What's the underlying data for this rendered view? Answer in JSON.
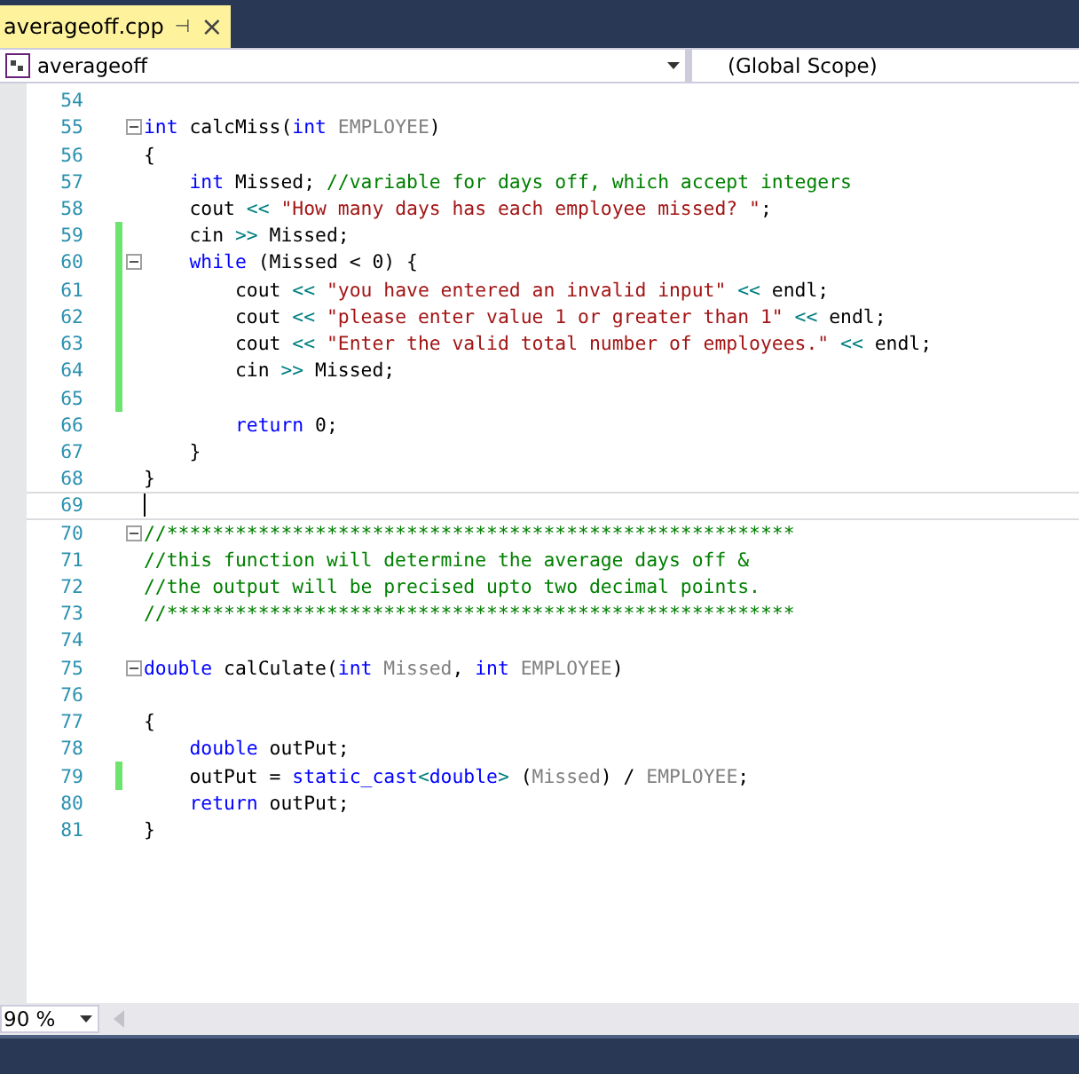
{
  "tab": {
    "title": "averageoff.cpp",
    "pin": "⊣",
    "close": "×",
    "selected": true
  },
  "navigation": {
    "project": "averageoff",
    "scope": "(Global Scope)"
  },
  "lines": [
    {
      "number": "54",
      "changed": false,
      "fold": false,
      "current": false
    },
    {
      "number": "55",
      "changed": false,
      "fold": true,
      "current": false,
      "tokens": [
        {
          "kind": "kw",
          "text": "int"
        },
        {
          "kind": "text",
          "text": " calcMiss("
        },
        {
          "kind": "kw",
          "text": "int"
        },
        {
          "kind": "param",
          "text": " EMPLOYEE"
        },
        {
          "kind": "text",
          "text": ")"
        }
      ]
    },
    {
      "number": "56",
      "changed": false,
      "fold": false,
      "current": false,
      "tokens": [
        {
          "kind": "text",
          "text": "{"
        }
      ]
    },
    {
      "number": "57",
      "changed": false,
      "fold": false,
      "current": false,
      "tokens": [
        {
          "kind": "kw",
          "text": "    int"
        },
        {
          "kind": "text",
          "text": " Missed; "
        },
        {
          "kind": "cmt",
          "text": "//variable for days off, which accept integers"
        }
      ]
    },
    {
      "number": "58",
      "changed": false,
      "fold": false,
      "current": false,
      "tokens": [
        {
          "kind": "text",
          "text": "    cout "
        },
        {
          "kind": "op",
          "text": "<<"
        },
        {
          "kind": "str",
          "text": " \"How many days has each employee missed? \""
        },
        {
          "kind": "text",
          "text": ";"
        }
      ]
    },
    {
      "number": "59",
      "changed": true,
      "fold": false,
      "current": false,
      "tokens": [
        {
          "kind": "text",
          "text": "    cin "
        },
        {
          "kind": "op",
          "text": ">>"
        },
        {
          "kind": "text",
          "text": " Missed;"
        }
      ]
    },
    {
      "number": "60",
      "changed": true,
      "fold": true,
      "current": false,
      "tokens": [
        {
          "kind": "kw",
          "text": "    while"
        },
        {
          "kind": "text",
          "text": " (Missed < 0) {"
        }
      ]
    },
    {
      "number": "61",
      "changed": true,
      "fold": false,
      "current": false,
      "tokens": [
        {
          "kind": "text",
          "text": "        cout "
        },
        {
          "kind": "op",
          "text": "<<"
        },
        {
          "kind": "str",
          "text": " \"you have entered an invalid input\""
        },
        {
          "kind": "op",
          "text": " <<"
        },
        {
          "kind": "text",
          "text": " endl;"
        }
      ]
    },
    {
      "number": "62",
      "changed": true,
      "fold": false,
      "current": false,
      "tokens": [
        {
          "kind": "text",
          "text": "        cout "
        },
        {
          "kind": "op",
          "text": "<<"
        },
        {
          "kind": "str",
          "text": " \"please enter value 1 or greater than 1\""
        },
        {
          "kind": "op",
          "text": " <<"
        },
        {
          "kind": "text",
          "text": " endl;"
        }
      ]
    },
    {
      "number": "63",
      "changed": true,
      "fold": false,
      "current": false,
      "tokens": [
        {
          "kind": "text",
          "text": "        cout "
        },
        {
          "kind": "op",
          "text": "<<"
        },
        {
          "kind": "str",
          "text": " \"Enter the valid total number of employees.\""
        },
        {
          "kind": "op",
          "text": " <<"
        },
        {
          "kind": "text",
          "text": " endl;"
        }
      ]
    },
    {
      "number": "64",
      "changed": true,
      "fold": false,
      "current": false,
      "tokens": [
        {
          "kind": "text",
          "text": "        cin "
        },
        {
          "kind": "op",
          "text": ">>"
        },
        {
          "kind": "text",
          "text": " Missed;"
        }
      ]
    },
    {
      "number": "65",
      "changed": true,
      "fold": false,
      "current": false
    },
    {
      "number": "66",
      "changed": false,
      "fold": false,
      "current": false,
      "tokens": [
        {
          "kind": "kw",
          "text": "        return"
        },
        {
          "kind": "text",
          "text": " 0;"
        }
      ]
    },
    {
      "number": "67",
      "changed": false,
      "fold": false,
      "current": false,
      "tokens": [
        {
          "kind": "text",
          "text": "    }"
        }
      ]
    },
    {
      "number": "68",
      "changed": false,
      "fold": false,
      "current": false,
      "tokens": [
        {
          "kind": "text",
          "text": "}"
        }
      ]
    },
    {
      "number": "69",
      "changed": false,
      "fold": false,
      "current": true
    },
    {
      "number": "70",
      "changed": false,
      "fold": true,
      "current": false,
      "tokens": [
        {
          "kind": "cmt",
          "text": "//*******************************************************"
        }
      ]
    },
    {
      "number": "71",
      "changed": false,
      "fold": false,
      "current": false,
      "tokens": [
        {
          "kind": "cmt",
          "text": "//this function will determine the average days off &"
        }
      ]
    },
    {
      "number": "72",
      "changed": false,
      "fold": false,
      "current": false,
      "tokens": [
        {
          "kind": "cmt",
          "text": "//the output will be precised upto two decimal points."
        }
      ]
    },
    {
      "number": "73",
      "changed": false,
      "fold": false,
      "current": false,
      "tokens": [
        {
          "kind": "cmt",
          "text": "//*******************************************************"
        }
      ]
    },
    {
      "number": "74",
      "changed": false,
      "fold": false,
      "current": false
    },
    {
      "number": "75",
      "changed": false,
      "fold": true,
      "current": false,
      "tokens": [
        {
          "kind": "kw",
          "text": "double"
        },
        {
          "kind": "text",
          "text": " calCulate("
        },
        {
          "kind": "kw",
          "text": "int"
        },
        {
          "kind": "param",
          "text": " Missed"
        },
        {
          "kind": "text",
          "text": ", "
        },
        {
          "kind": "kw",
          "text": "int"
        },
        {
          "kind": "param",
          "text": " EMPLOYEE"
        },
        {
          "kind": "text",
          "text": ")"
        }
      ]
    },
    {
      "number": "76",
      "changed": false,
      "fold": false,
      "current": false
    },
    {
      "number": "77",
      "changed": false,
      "fold": false,
      "current": false,
      "tokens": [
        {
          "kind": "text",
          "text": "{"
        }
      ]
    },
    {
      "number": "78",
      "changed": false,
      "fold": false,
      "current": false,
      "tokens": [
        {
          "kind": "kw",
          "text": "    double"
        },
        {
          "kind": "text",
          "text": " outPut;"
        }
      ]
    },
    {
      "number": "79",
      "changed": true,
      "fold": false,
      "current": false,
      "tokens": [
        {
          "kind": "text",
          "text": "    outPut = "
        },
        {
          "kind": "kw",
          "text": "static_cast"
        },
        {
          "kind": "op",
          "text": "<"
        },
        {
          "kind": "kw",
          "text": "double"
        },
        {
          "kind": "op",
          "text": ">"
        },
        {
          "kind": "text",
          "text": " ("
        },
        {
          "kind": "param",
          "text": "Missed"
        },
        {
          "kind": "text",
          "text": ") / "
        },
        {
          "kind": "param",
          "text": "EMPLOYEE"
        },
        {
          "kind": "text",
          "text": ";"
        }
      ]
    },
    {
      "number": "80",
      "changed": false,
      "fold": false,
      "current": false,
      "tokens": [
        {
          "kind": "kw",
          "text": "    return"
        },
        {
          "kind": "text",
          "text": " outPut;"
        }
      ]
    },
    {
      "number": "81",
      "changed": false,
      "fold": false,
      "current": false,
      "tokens": [
        {
          "kind": "text",
          "text": "}"
        }
      ]
    }
  ],
  "zoom": {
    "value": "90 %"
  }
}
